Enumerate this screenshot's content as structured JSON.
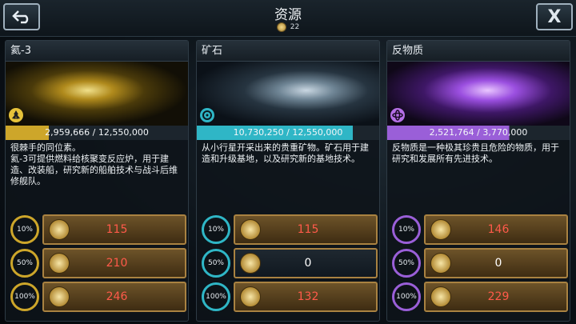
{
  "header": {
    "title": "资源",
    "currency_value": "22",
    "close_label": "X"
  },
  "colors": {
    "he3": "#cda62a",
    "ore": "#2fb6c6",
    "antimatter": "#9a5fd8",
    "cost": "#ff5a4a",
    "neutral": "#ffffff"
  },
  "panels": [
    {
      "name": "氦-3",
      "icon": "radiation-icon",
      "progress_text": "2,959,666 / 12,550,000",
      "progress_fraction": 0.236,
      "description": "很棘手的同位素。\n氦-3可提供燃料给核聚变反应炉，用于建造、改装船，研究新的船舶技术与战斗后维修舰队。",
      "options": [
        {
          "percent": "10%",
          "cost": "115"
        },
        {
          "percent": "50%",
          "cost": "210"
        },
        {
          "percent": "100%",
          "cost": "246"
        }
      ]
    },
    {
      "name": "矿石",
      "icon": "target-icon",
      "progress_text": "10,730,250 / 12,550,000",
      "progress_fraction": 0.855,
      "description": "从小行星开采出来的贵重矿物。矿石用于建造和升级基地，以及研究新的基地技术。",
      "options": [
        {
          "percent": "10%",
          "cost": "115"
        },
        {
          "percent": "50%",
          "cost": "0"
        },
        {
          "percent": "100%",
          "cost": "132"
        }
      ]
    },
    {
      "name": "反物质",
      "icon": "atom-icon",
      "progress_text": "2,521,764 / 3,770,000",
      "progress_fraction": 0.669,
      "description": "反物质是一种极其珍贵且危险的物质，用于研究和发展所有先进技术。",
      "options": [
        {
          "percent": "10%",
          "cost": "146"
        },
        {
          "percent": "50%",
          "cost": "0"
        },
        {
          "percent": "100%",
          "cost": "229"
        }
      ]
    }
  ]
}
